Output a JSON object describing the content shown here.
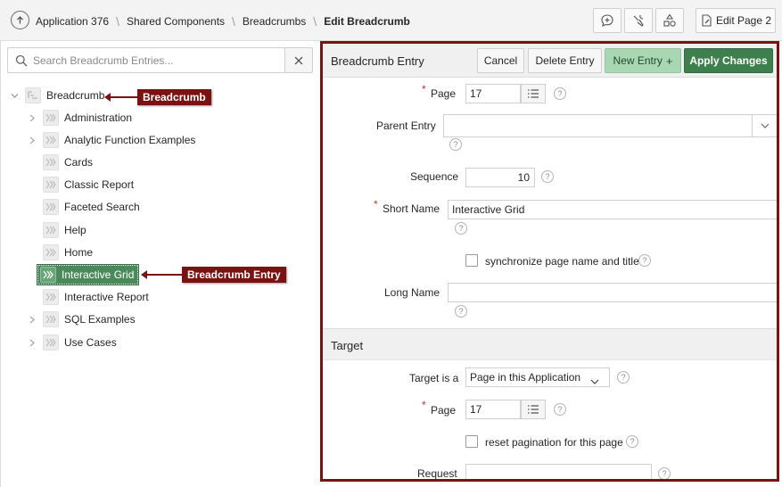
{
  "header": {
    "breadcrumbs": [
      {
        "label": "Application 376"
      },
      {
        "label": "Shared Components"
      },
      {
        "label": "Breadcrumbs"
      },
      {
        "label": "Edit Breadcrumb"
      }
    ],
    "edit_page_label": "Edit Page 2"
  },
  "tree": {
    "search_placeholder": "Search Breadcrumb Entries...",
    "root": "Breadcrumb",
    "items": [
      {
        "label": "Administration",
        "has_children": true
      },
      {
        "label": "Analytic Function Examples",
        "has_children": true
      },
      {
        "label": "Cards",
        "has_children": false
      },
      {
        "label": "Classic Report",
        "has_children": false
      },
      {
        "label": "Faceted Search",
        "has_children": false
      },
      {
        "label": "Help",
        "has_children": false
      },
      {
        "label": "Home",
        "has_children": false
      },
      {
        "label": "Interactive Grid",
        "has_children": false,
        "selected": true
      },
      {
        "label": "Interactive Report",
        "has_children": false
      },
      {
        "label": "SQL Examples",
        "has_children": true
      },
      {
        "label": "Use Cases",
        "has_children": true
      }
    ]
  },
  "callouts": {
    "breadcrumb": "Breadcrumb",
    "entry": "Breadcrumb Entry"
  },
  "form": {
    "region_title": "Breadcrumb Entry",
    "buttons": {
      "cancel": "Cancel",
      "delete": "Delete Entry",
      "new_entry": "New Entry",
      "new_entry_plus": "+",
      "apply": "Apply Changes"
    },
    "page": {
      "label": "Page",
      "value": "17"
    },
    "parent_entry": {
      "label": "Parent Entry",
      "value": ""
    },
    "sequence": {
      "label": "Sequence",
      "value": "10"
    },
    "short_name": {
      "label": "Short Name",
      "value": "Interactive Grid"
    },
    "sync_label": "synchronize page name and title",
    "long_name": {
      "label": "Long Name",
      "value": ""
    },
    "required_mark": "*",
    "help_mark": "?"
  },
  "target": {
    "section_title": "Target",
    "target_is": {
      "label": "Target is a",
      "value": "Page in this Application"
    },
    "page": {
      "label": "Page",
      "value": "17"
    },
    "reset_label": "reset pagination for this page",
    "request": {
      "label": "Request",
      "value": ""
    }
  },
  "colors": {
    "accent_dark_red": "#7a1212",
    "apply_green": "#3e7f4e",
    "new_entry_green": "#a9d7b4",
    "selected_node": "#4a8a5a"
  }
}
